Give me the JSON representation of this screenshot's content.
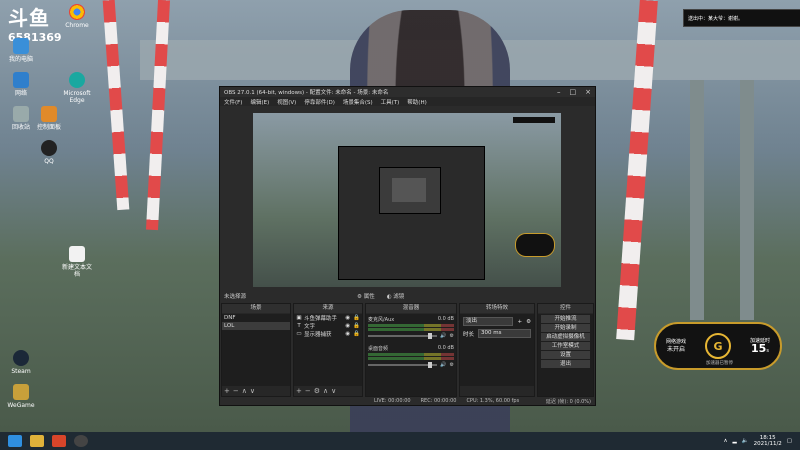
{
  "stream_id": "6581369",
  "notice_text": "送出中：某大爷：谢谢。",
  "desktop_icons": [
    {
      "label": "我的电脑"
    },
    {
      "label": "Chrome"
    },
    {
      "label": "网络"
    },
    {
      "label": "Microsoft Edge"
    },
    {
      "label": "回收站"
    },
    {
      "label": "控制面板"
    },
    {
      "label": "QQ"
    },
    {
      "label": "Steam"
    },
    {
      "label": "WeGame"
    },
    {
      "label": "新建文本文档"
    }
  ],
  "obs": {
    "title": "OBS 27.0.1 (64-bit, windows) - 配置文件: 未命名 - 场景: 未命名",
    "menu": [
      "文件(F)",
      "编辑(E)",
      "视图(V)",
      "停靠部件(D)",
      "场景集合(S)",
      "工具(T)",
      "帮助(H)"
    ],
    "context_label": "未选择源",
    "context_props": "属性",
    "context_filters": "滤镜",
    "docks": {
      "scenes": {
        "title": "场景",
        "items": [
          "DNF",
          "LOL"
        ]
      },
      "sources": {
        "title": "来源",
        "items": [
          "斗鱼弹幕助手",
          "文字",
          "显示器捕获"
        ]
      },
      "mixer": {
        "title": "混音器",
        "channels": [
          {
            "name": "麦克风/Aux",
            "db": "0.0 dB"
          },
          {
            "name": "桌面音频",
            "db": "0.0 dB"
          }
        ]
      },
      "transitions": {
        "title": "转场特效",
        "type": "淡出",
        "duration_label": "时长",
        "duration": "300 ms"
      },
      "controls": {
        "title": "控件",
        "buttons": [
          "开始推流",
          "开始录制",
          "启动虚拟摄像机",
          "工作室模式",
          "设置",
          "退出"
        ]
      }
    },
    "status": {
      "live": "LIVE: 00:00:00",
      "rec": "REC: 00:00:00",
      "cpu": "CPU: 1.3%, 60.00 fps",
      "right": "延迟 (帧): 0 (0.0%)"
    }
  },
  "widget": {
    "left_label": "网络游戏",
    "left_value": "未开启",
    "right_label": "加速延时",
    "right_value": "15",
    "right_unit": "s",
    "sub": "加速器已暂停"
  },
  "clock": {
    "time": "18:15",
    "date": "2021/11/2"
  }
}
